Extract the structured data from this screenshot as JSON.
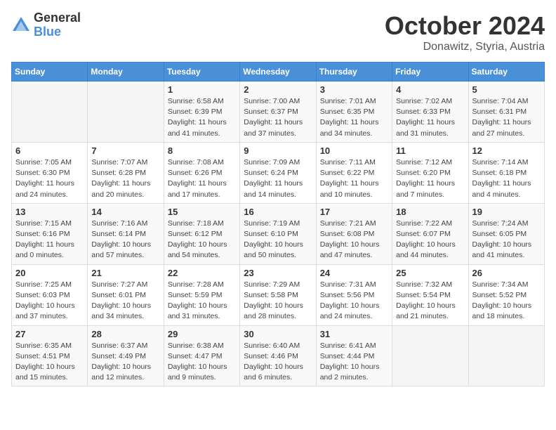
{
  "header": {
    "logo_general": "General",
    "logo_blue": "Blue",
    "month_title": "October 2024",
    "subtitle": "Donawitz, Styria, Austria"
  },
  "weekdays": [
    "Sunday",
    "Monday",
    "Tuesday",
    "Wednesday",
    "Thursday",
    "Friday",
    "Saturday"
  ],
  "weeks": [
    [
      {
        "day": "",
        "info": ""
      },
      {
        "day": "",
        "info": ""
      },
      {
        "day": "1",
        "info": "Sunrise: 6:58 AM\nSunset: 6:39 PM\nDaylight: 11 hours and 41 minutes."
      },
      {
        "day": "2",
        "info": "Sunrise: 7:00 AM\nSunset: 6:37 PM\nDaylight: 11 hours and 37 minutes."
      },
      {
        "day": "3",
        "info": "Sunrise: 7:01 AM\nSunset: 6:35 PM\nDaylight: 11 hours and 34 minutes."
      },
      {
        "day": "4",
        "info": "Sunrise: 7:02 AM\nSunset: 6:33 PM\nDaylight: 11 hours and 31 minutes."
      },
      {
        "day": "5",
        "info": "Sunrise: 7:04 AM\nSunset: 6:31 PM\nDaylight: 11 hours and 27 minutes."
      }
    ],
    [
      {
        "day": "6",
        "info": "Sunrise: 7:05 AM\nSunset: 6:30 PM\nDaylight: 11 hours and 24 minutes."
      },
      {
        "day": "7",
        "info": "Sunrise: 7:07 AM\nSunset: 6:28 PM\nDaylight: 11 hours and 20 minutes."
      },
      {
        "day": "8",
        "info": "Sunrise: 7:08 AM\nSunset: 6:26 PM\nDaylight: 11 hours and 17 minutes."
      },
      {
        "day": "9",
        "info": "Sunrise: 7:09 AM\nSunset: 6:24 PM\nDaylight: 11 hours and 14 minutes."
      },
      {
        "day": "10",
        "info": "Sunrise: 7:11 AM\nSunset: 6:22 PM\nDaylight: 11 hours and 10 minutes."
      },
      {
        "day": "11",
        "info": "Sunrise: 7:12 AM\nSunset: 6:20 PM\nDaylight: 11 hours and 7 minutes."
      },
      {
        "day": "12",
        "info": "Sunrise: 7:14 AM\nSunset: 6:18 PM\nDaylight: 11 hours and 4 minutes."
      }
    ],
    [
      {
        "day": "13",
        "info": "Sunrise: 7:15 AM\nSunset: 6:16 PM\nDaylight: 11 hours and 0 minutes."
      },
      {
        "day": "14",
        "info": "Sunrise: 7:16 AM\nSunset: 6:14 PM\nDaylight: 10 hours and 57 minutes."
      },
      {
        "day": "15",
        "info": "Sunrise: 7:18 AM\nSunset: 6:12 PM\nDaylight: 10 hours and 54 minutes."
      },
      {
        "day": "16",
        "info": "Sunrise: 7:19 AM\nSunset: 6:10 PM\nDaylight: 10 hours and 50 minutes."
      },
      {
        "day": "17",
        "info": "Sunrise: 7:21 AM\nSunset: 6:08 PM\nDaylight: 10 hours and 47 minutes."
      },
      {
        "day": "18",
        "info": "Sunrise: 7:22 AM\nSunset: 6:07 PM\nDaylight: 10 hours and 44 minutes."
      },
      {
        "day": "19",
        "info": "Sunrise: 7:24 AM\nSunset: 6:05 PM\nDaylight: 10 hours and 41 minutes."
      }
    ],
    [
      {
        "day": "20",
        "info": "Sunrise: 7:25 AM\nSunset: 6:03 PM\nDaylight: 10 hours and 37 minutes."
      },
      {
        "day": "21",
        "info": "Sunrise: 7:27 AM\nSunset: 6:01 PM\nDaylight: 10 hours and 34 minutes."
      },
      {
        "day": "22",
        "info": "Sunrise: 7:28 AM\nSunset: 5:59 PM\nDaylight: 10 hours and 31 minutes."
      },
      {
        "day": "23",
        "info": "Sunrise: 7:29 AM\nSunset: 5:58 PM\nDaylight: 10 hours and 28 minutes."
      },
      {
        "day": "24",
        "info": "Sunrise: 7:31 AM\nSunset: 5:56 PM\nDaylight: 10 hours and 24 minutes."
      },
      {
        "day": "25",
        "info": "Sunrise: 7:32 AM\nSunset: 5:54 PM\nDaylight: 10 hours and 21 minutes."
      },
      {
        "day": "26",
        "info": "Sunrise: 7:34 AM\nSunset: 5:52 PM\nDaylight: 10 hours and 18 minutes."
      }
    ],
    [
      {
        "day": "27",
        "info": "Sunrise: 6:35 AM\nSunset: 4:51 PM\nDaylight: 10 hours and 15 minutes."
      },
      {
        "day": "28",
        "info": "Sunrise: 6:37 AM\nSunset: 4:49 PM\nDaylight: 10 hours and 12 minutes."
      },
      {
        "day": "29",
        "info": "Sunrise: 6:38 AM\nSunset: 4:47 PM\nDaylight: 10 hours and 9 minutes."
      },
      {
        "day": "30",
        "info": "Sunrise: 6:40 AM\nSunset: 4:46 PM\nDaylight: 10 hours and 6 minutes."
      },
      {
        "day": "31",
        "info": "Sunrise: 6:41 AM\nSunset: 4:44 PM\nDaylight: 10 hours and 2 minutes."
      },
      {
        "day": "",
        "info": ""
      },
      {
        "day": "",
        "info": ""
      }
    ]
  ]
}
